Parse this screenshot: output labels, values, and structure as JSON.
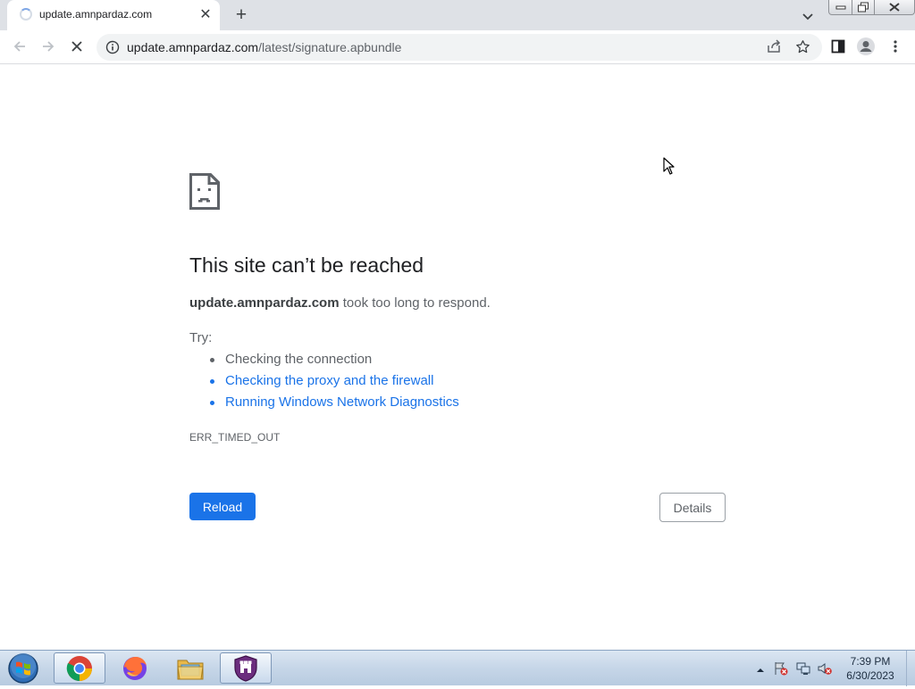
{
  "browser": {
    "tab": {
      "title": "update.amnpardaz.com"
    },
    "address": {
      "domain": "update.amnpardaz.com",
      "path": "/latest/signature.apbundle"
    },
    "icons": [
      "back-icon",
      "forward-icon",
      "stop-icon",
      "info-icon",
      "share-icon",
      "star-icon",
      "side-panel-icon",
      "profile-icon",
      "menu-icon"
    ]
  },
  "error": {
    "title": "This site can’t be reached",
    "host": "update.amnpardaz.com",
    "message": " took too long to respond.",
    "try_label": "Try:",
    "suggestions": [
      "Checking the connection",
      "Checking the proxy and the firewall",
      "Running Windows Network Diagnostics"
    ],
    "code": "ERR_TIMED_OUT",
    "reload_label": "Reload",
    "details_label": "Details"
  },
  "taskbar": {
    "apps": [
      "chrome",
      "firefox",
      "file-explorer",
      "shield-app"
    ],
    "time": "7:39 PM",
    "date": "6/30/2023"
  },
  "colors": {
    "link": "#1a73e8",
    "button": "#1a73e8",
    "text": "#202124",
    "secondary": "#5f6368"
  }
}
